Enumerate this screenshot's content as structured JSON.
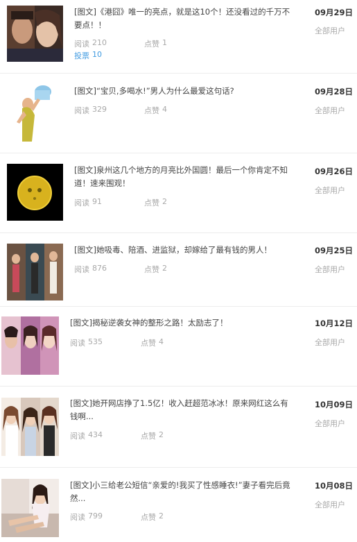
{
  "articles": [
    {
      "title": "[图文]《港囧》唯一的亮点，就是这10个！还没看过的千万不要点！！",
      "read_label": "阅读",
      "read_count": "210",
      "like_label": "点赞",
      "like_count": "1",
      "vote_label": "投票",
      "vote_count": "10",
      "date": "09月29日",
      "audience": "全部用户"
    },
    {
      "title": "[图文]“宝贝,多喝水!”男人为什么最爱这句话?",
      "read_label": "阅读",
      "read_count": "329",
      "like_label": "点赞",
      "like_count": "4",
      "date": "09月28日",
      "audience": "全部用户"
    },
    {
      "title": "[图文]泉州这几个地方的月亮比外国圆！最后一个你肯定不知道！速来围观！",
      "read_label": "阅读",
      "read_count": "91",
      "like_label": "点赞",
      "like_count": "2",
      "date": "09月26日",
      "audience": "全部用户"
    },
    {
      "title": "[图文]她吸毒、陪酒、进监狱，却嫁给了最有钱的男人！",
      "read_label": "阅读",
      "read_count": "876",
      "like_label": "点赞",
      "like_count": "2",
      "date": "09月25日",
      "audience": "全部用户"
    },
    {
      "title": "[图文]揭秘逆袭女神的整形之路！太励志了！",
      "read_label": "阅读",
      "read_count": "535",
      "like_label": "点赞",
      "like_count": "4",
      "date": "10月12日",
      "audience": "全部用户"
    },
    {
      "title": "[图文]她开网店挣了1.5亿！收入赶超范冰冰！原来网红这么有钱啊...",
      "read_label": "阅读",
      "read_count": "434",
      "like_label": "点赞",
      "like_count": "2",
      "date": "10月09日",
      "audience": "全部用户"
    },
    {
      "title": "[图文]小三给老公短信“亲爱的!我买了性感睡衣!”妻子看完后竟然...",
      "read_label": "阅读",
      "read_count": "799",
      "like_label": "点赞",
      "like_count": "2",
      "date": "10月08日",
      "audience": "全部用户"
    }
  ]
}
